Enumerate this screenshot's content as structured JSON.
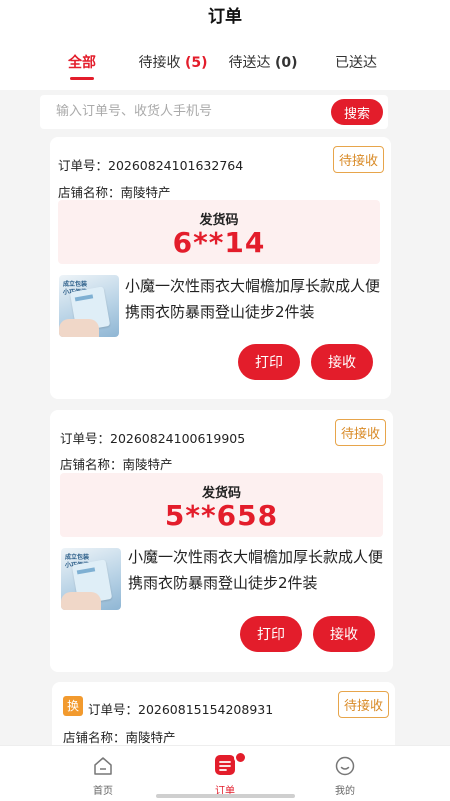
{
  "header": {
    "title": "订单"
  },
  "tabs": [
    {
      "label": "全部",
      "count": ""
    },
    {
      "label": "待接收",
      "count": "(5)"
    },
    {
      "label": "待送达",
      "count": "(0)"
    },
    {
      "label": "已送达",
      "count": ""
    }
  ],
  "search": {
    "placeholder": "输入订单号、收货人手机号",
    "value": "",
    "button_label": "搜索"
  },
  "orders": [
    {
      "order_no": "订单号：20260824101632764",
      "shop": "店铺名称：南陵特产",
      "status": "待接收",
      "code_label": "发货码",
      "code": "6**14",
      "product_name": "小魔一次性雨衣大帽檐加厚长款成人便携雨衣防暴雨登山徒步2件装",
      "thumb_text": "成立包装\n小巧便携",
      "print_label": "打印",
      "accept_label": "接收"
    },
    {
      "order_no": "订单号：20260824100619905",
      "shop": "店铺名称：南陵特产",
      "status": "待接收",
      "code_label": "发货码",
      "code": "5**658",
      "product_name": "小魔一次性雨衣大帽檐加厚长款成人便携雨衣防暴雨登山徒步2件装",
      "thumb_text": "成立包装\n小巧便携",
      "print_label": "打印",
      "accept_label": "接收"
    },
    {
      "swap_badge": "换",
      "order_no": "订单号：20260815154208931",
      "shop": "店铺名称：南陵特产",
      "status": "待接收"
    }
  ],
  "bottom_nav": [
    {
      "label": "首页",
      "icon": "home-icon"
    },
    {
      "label": "订单",
      "icon": "orders-icon"
    },
    {
      "label": "我的",
      "icon": "profile-icon"
    }
  ],
  "colors": {
    "accent": "#e31d2b",
    "status": "#d98b28",
    "code_bg": "#fdf0f0"
  }
}
